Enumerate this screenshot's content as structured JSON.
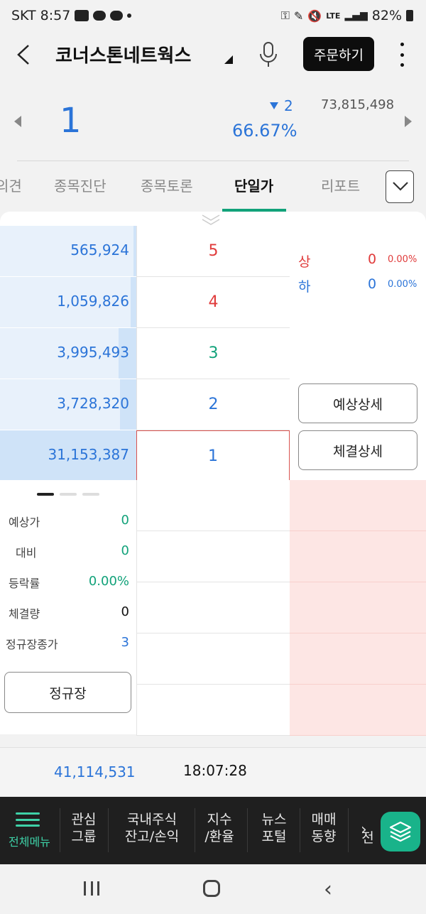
{
  "status_bar": {
    "carrier": "SKT",
    "time": "8:57",
    "battery": "82%",
    "network": "LTE"
  },
  "header": {
    "back_icon": "back-arrow-icon",
    "title": "코너스톤네트웍스",
    "order_button": "주문하기"
  },
  "price": {
    "current": "1",
    "change": "2",
    "change_rate": "66.67%",
    "volume": "73,815,498"
  },
  "tabs": [
    {
      "label": "의견",
      "active": false
    },
    {
      "label": "종목진단",
      "active": false
    },
    {
      "label": "종목토론",
      "active": false
    },
    {
      "label": "단일가",
      "active": true
    },
    {
      "label": "리포트",
      "active": false
    }
  ],
  "orderbook": {
    "asks": [
      {
        "qty": "565,924",
        "price": "5",
        "color": "red",
        "fill": 0.02
      },
      {
        "qty": "1,059,826",
        "price": "4",
        "color": "red",
        "fill": 0.04
      },
      {
        "qty": "3,995,493",
        "price": "3",
        "color": "green",
        "fill": 0.13
      },
      {
        "qty": "3,728,320",
        "price": "2",
        "color": "blue",
        "fill": 0.12
      },
      {
        "qty": "31,153,387",
        "price": "1",
        "color": "blue",
        "fill": 1.0
      }
    ],
    "limits": {
      "upper_label": "상",
      "upper_value": "0",
      "upper_rate": "0.00%",
      "lower_label": "하",
      "lower_value": "0",
      "lower_rate": "0.00%"
    },
    "buttons": {
      "expected_detail": "예상상세",
      "trade_detail": "체결상세"
    }
  },
  "info": {
    "rows": [
      {
        "label": "예상가",
        "value": "0",
        "color": "#12a27a"
      },
      {
        "label": "대비",
        "value": "0",
        "color": "#12a27a"
      },
      {
        "label": "등락률",
        "value": "0.00%",
        "color": "#12a27a"
      },
      {
        "label": "체결량",
        "value": "0",
        "color": "#111111"
      },
      {
        "label": "정규장종가",
        "value": "3",
        "color": "#2b74d8"
      }
    ],
    "regular_button": "정규장"
  },
  "summary": {
    "total_volume": "41,114,531",
    "time": "18:07:28"
  },
  "bottom_menu": {
    "all_menu": "전체메뉴",
    "items": [
      {
        "line1": "관심",
        "line2": "그룹"
      },
      {
        "line1": "국내주식",
        "line2": "잔고/손익"
      },
      {
        "line1": "지수",
        "line2": "/환율"
      },
      {
        "line1": "뉴스",
        "line2": "포털"
      },
      {
        "line1": "매매",
        "line2": "동향"
      },
      {
        "line1": "전",
        "line2": ""
      }
    ]
  },
  "colors": {
    "accent_green": "#12a27a",
    "down_blue": "#2b74d8",
    "up_red": "#e03b3b"
  }
}
